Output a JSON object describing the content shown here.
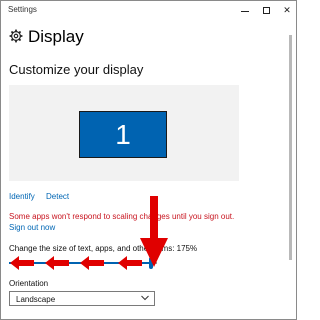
{
  "window": {
    "title": "Settings",
    "controls": {
      "minimize": "minimize-icon",
      "maximize": "maximize-icon",
      "close": "✕"
    }
  },
  "header": {
    "title": "Display",
    "icon": "gear-icon"
  },
  "section": {
    "title": "Customize your display"
  },
  "display_preview": {
    "monitor_number": "1",
    "monitor_color": "#0063b1"
  },
  "actions": {
    "identify": "Identify",
    "detect": "Detect"
  },
  "warning": {
    "text": "Some apps won't respond to scaling changes until you sign out.",
    "color": "#c8141f"
  },
  "signout": {
    "label": "Sign out now"
  },
  "scaling": {
    "label": "Change the size of text, apps, and other items: 175%",
    "slider_level": 0.96
  },
  "orientation": {
    "label": "Orientation",
    "selected": "Landscape"
  },
  "annotations": {
    "arrow_color": "#e00000"
  },
  "colors": {
    "accent": "#0063b1",
    "link": "#0066b4"
  }
}
